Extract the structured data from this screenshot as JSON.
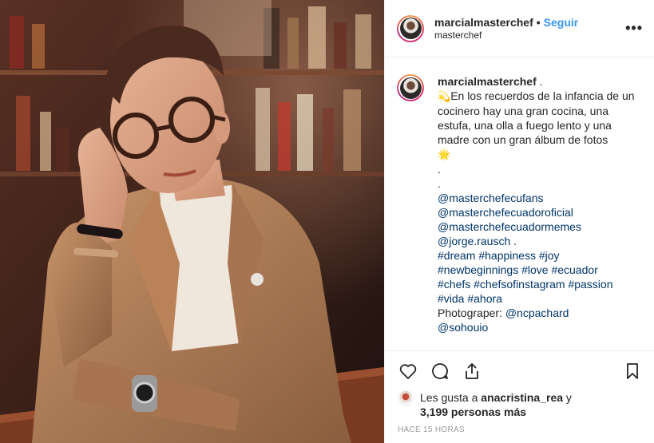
{
  "post": {
    "username": "marcialmasterchef",
    "separator": "•",
    "follow_label": "Seguir",
    "location": "masterchef",
    "more_label": "•••"
  },
  "caption": {
    "username": "marcialmasterchef",
    "username_suffix": ".",
    "emoji_start": "💫",
    "text": "En los recuerdos de la infancia de un cocinero hay una gran cocina, una estufa, una olla a fuego lento y una madre con un gran álbum de fotos",
    "emoji_end": "🌟",
    "dot1": ".",
    "dot2": ".",
    "mentions": [
      "@masterchefecufans",
      "@masterchefecuadoroficial",
      "@masterchefecuadormemes"
    ],
    "mention_last": "@jorge.rausch",
    "mention_last_suffix": ".",
    "hashtags_line1": [
      "#dream",
      "#happiness",
      "#joy"
    ],
    "hashtags_line2": [
      "#newbeginnings",
      "#love",
      "#ecuador"
    ],
    "hashtags_line3": [
      "#chefs",
      "#chefsofinstagram",
      "#passion"
    ],
    "hashtags_line4": [
      "#vida",
      "#ahora"
    ],
    "photographer_label": "Photograper:",
    "photographer": "@ncpachard",
    "final_mention": "@sohouio"
  },
  "likes": {
    "prefix": "Les gusta a",
    "user": "anacristina_rea",
    "conj": "y",
    "count_text": "3,199 personas más"
  },
  "timestamp": "HACE 15 HORAS",
  "icons": {
    "like": "heart-icon",
    "comment": "comment-bubble-icon",
    "share": "share-icon",
    "save": "bookmark-icon"
  },
  "colors": {
    "link": "#003569",
    "follow": "#3897f0",
    "muted": "#999999",
    "border": "#efefef"
  }
}
